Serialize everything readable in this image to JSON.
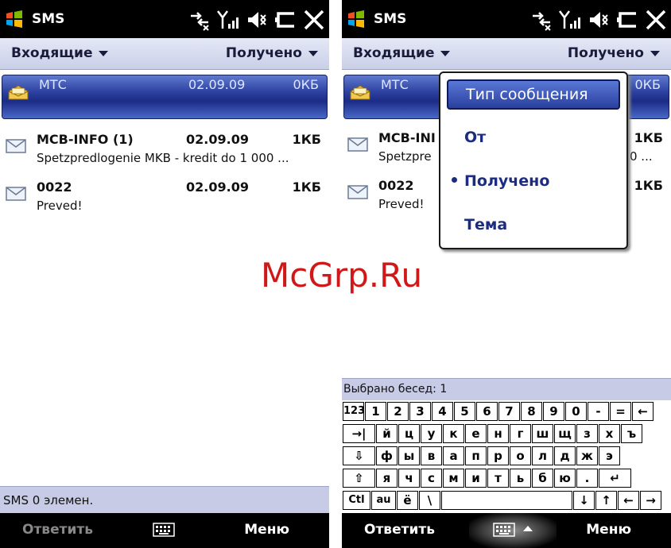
{
  "title": "SMS",
  "header": {
    "folder_label": "Входящие",
    "sort_label": "Получено"
  },
  "messages": [
    {
      "sender": "МТС",
      "date": "02.09.09",
      "size": "0КБ",
      "preview": "",
      "selected": true
    },
    {
      "sender": "MCB-INFO (1)",
      "date": "02.09.09",
      "size": "1КБ",
      "preview": "Spetzpredlogenie  MKB -  kredit do 1 000 ..."
    },
    {
      "sender": "0022",
      "date": "02.09.09",
      "size": "1КБ",
      "preview": "Preved!"
    }
  ],
  "right_messages": [
    {
      "sender": "МТС",
      "size": "0КБ"
    },
    {
      "sender": "MCB-INI",
      "size": "1КБ",
      "preview": "Spetzpre",
      "preview_tail": "0 ..."
    },
    {
      "sender": "0022",
      "size": "1КБ",
      "preview": "Preved!"
    }
  ],
  "left_status": "SMS  0 элемен.",
  "selected_status": "Выбрано бесед: 1",
  "softkeys": {
    "left": "Ответить",
    "right": "Меню"
  },
  "sort_menu": {
    "items": [
      "Тип сообщения",
      "От",
      "Получено",
      "Тема"
    ],
    "highlighted_index": 0,
    "checked_index": 2
  },
  "keyboard": {
    "rows": [
      [
        "123",
        "1",
        "2",
        "3",
        "4",
        "5",
        "6",
        "7",
        "8",
        "9",
        "0",
        "-",
        "=",
        "←"
      ],
      [
        "→|",
        "й",
        "ц",
        "у",
        "к",
        "е",
        "н",
        "г",
        "ш",
        "щ",
        "з",
        "х",
        "ъ"
      ],
      [
        "⇩",
        "ф",
        "ы",
        "в",
        "а",
        "п",
        "р",
        "о",
        "л",
        "д",
        "ж",
        "э"
      ],
      [
        "⇧",
        "я",
        "ч",
        "с",
        "м",
        "и",
        "т",
        "ь",
        "б",
        "ю",
        ".",
        "↵"
      ],
      [
        "Ctl",
        "au",
        "ё",
        "\\",
        " ",
        "↓",
        "↑",
        "←",
        "→"
      ]
    ]
  },
  "watermark": "McGrp.Ru",
  "colors": {
    "selection": "#2b3f9e",
    "header": "#c9cfe8",
    "status": "#c7cbe6",
    "titlebar": "#000000",
    "watermark": "#d01818"
  }
}
